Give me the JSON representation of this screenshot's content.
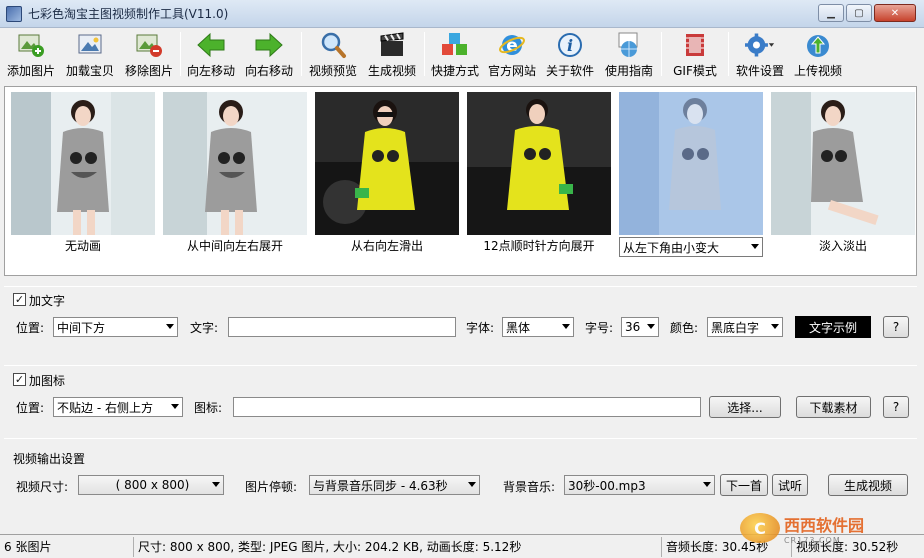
{
  "window": {
    "title": "七彩色淘宝主图视频制作工具(V11.0)"
  },
  "toolbar": {
    "items": [
      {
        "label": "添加图片",
        "icon": "add-image-icon"
      },
      {
        "label": "加载宝贝",
        "icon": "load-product-icon"
      },
      {
        "label": "移除图片",
        "icon": "remove-image-icon"
      },
      {
        "label": "向左移动",
        "icon": "arrow-left-icon"
      },
      {
        "label": "向右移动",
        "icon": "arrow-right-icon"
      },
      {
        "label": "视频预览",
        "icon": "magnifier-icon"
      },
      {
        "label": "生成视频",
        "icon": "clapperboard-icon"
      },
      {
        "label": "快捷方式",
        "icon": "cubes-icon"
      },
      {
        "label": "官方网站",
        "icon": "ie-icon"
      },
      {
        "label": "关于软件",
        "icon": "info-icon"
      },
      {
        "label": "使用指南",
        "icon": "guide-globe-icon"
      },
      {
        "label": "GIF模式",
        "icon": "gif-film-icon"
      },
      {
        "label": "软件设置",
        "icon": "gear-icon"
      },
      {
        "label": "上传视频",
        "icon": "upload-globe-icon"
      }
    ]
  },
  "thumbnails": [
    {
      "caption": "无动画",
      "palette": "gray-dress"
    },
    {
      "caption": "从中间向左右展开",
      "palette": "gray-dress"
    },
    {
      "caption": "从右向左滑出",
      "palette": "yellow-dress"
    },
    {
      "caption": "12点顺时针方向展开",
      "palette": "yellow-dress"
    },
    {
      "caption": "从左下角由小变大",
      "palette": "blue-tint",
      "is_select": true
    },
    {
      "caption": "淡入淡出",
      "palette": "gray-dress"
    }
  ],
  "text_group": {
    "checkbox_label": "加文字",
    "checked": true,
    "position_label": "位置:",
    "position_value": "中间下方",
    "text_label": "文字:",
    "text_value": "",
    "font_label": "字体:",
    "font_value": "黑体",
    "size_label": "字号:",
    "size_value": "36",
    "color_label": "颜色:",
    "color_value": "黑底白字",
    "sample_button": "文字示例",
    "help_button": "?"
  },
  "icon_group": {
    "checkbox_label": "加图标",
    "checked": true,
    "position_label": "位置:",
    "position_value": "不贴边 - 右侧上方",
    "icon_label": "图标:",
    "icon_value": "",
    "choose_button": "选择...",
    "download_button": "下载素材",
    "help_button": "?"
  },
  "output_group": {
    "title": "视频输出设置",
    "size_label": "视频尺寸:",
    "size_value": "( 800 x  800)",
    "pause_label": "图片停顿:",
    "pause_value": "与背景音乐同步 - 4.63秒",
    "music_label": "背景音乐:",
    "music_value": "30秒-00.mp3",
    "next_button": "下一首",
    "listen_button": "试听",
    "generate_button": "生成视频"
  },
  "status": {
    "count": "6 张图片",
    "info": "尺寸: 800 x 800, 类型: JPEG 图片, 大小: 204.2 KB, 动画长度: 5.12秒",
    "audio_length": "音频长度: 30.45秒",
    "video_length": "视频长度: 30.52秒"
  },
  "watermark": {
    "logo": "C",
    "main": "西西软件园",
    "sub": "CR173.COM"
  },
  "colors": {
    "titlebar": "#c4d5ea",
    "accent_green": "#3a9d23",
    "panel_bg": "#f0f0f0"
  }
}
